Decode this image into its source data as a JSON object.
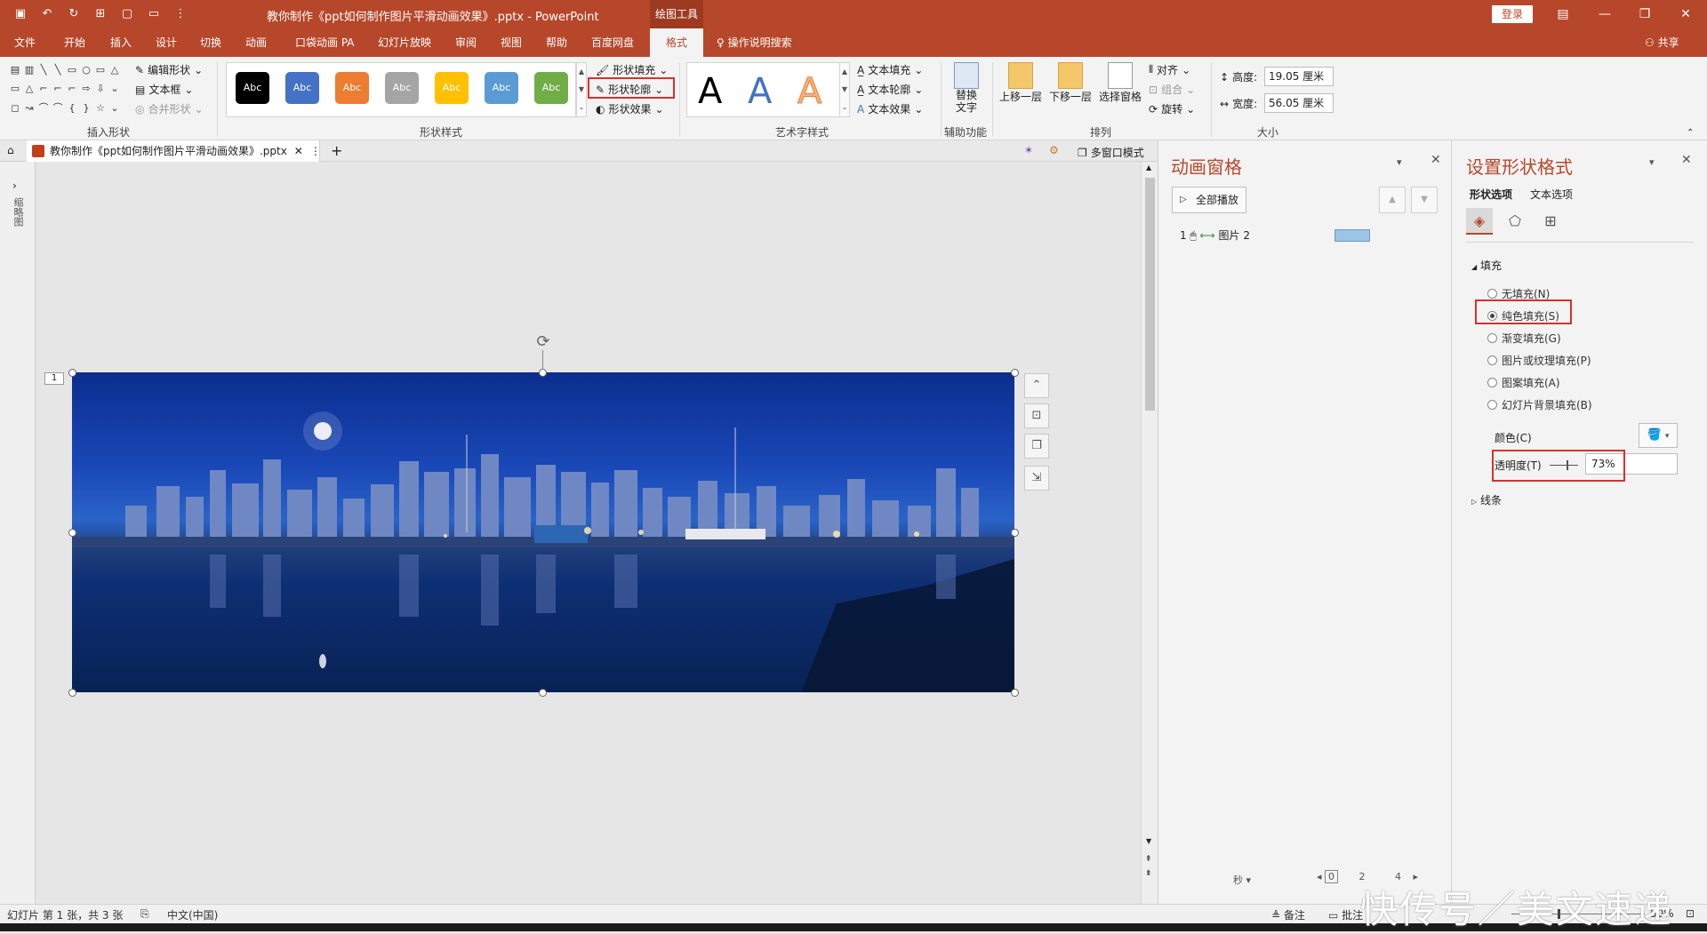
{
  "window": {
    "title": "教你制作《ppt如何制作图片平滑动画效果》.pptx - PowerPoint",
    "contextual_tab": "绘图工具",
    "login": "登录"
  },
  "tabs": [
    "文件",
    "开始",
    "插入",
    "设计",
    "切换",
    "动画",
    "口袋动画 PA",
    "幻灯片放映",
    "审阅",
    "视图",
    "帮助",
    "百度网盘",
    "格式"
  ],
  "tell_me": "操作说明搜索",
  "share": "共享",
  "ribbon": {
    "insert_shapes": {
      "label": "插入形状",
      "edit_shape": "编辑形状",
      "text_box": "文本框",
      "merge_shapes": "合并形状"
    },
    "shape_styles": {
      "label": "形状样式",
      "swatch_text": "Abc",
      "fill": "形状填充",
      "outline": "形状轮廓",
      "effects": "形状效果"
    },
    "wordart": {
      "label": "艺术字样式",
      "letter": "A",
      "text_fill": "文本填充",
      "text_outline": "文本轮廓",
      "text_effects": "文本效果"
    },
    "accessibility": {
      "label": "辅助功能",
      "alt_text": "替换文字"
    },
    "arrange": {
      "label": "排列",
      "bring_forward": "上移一层",
      "send_backward": "下移一层",
      "selection_pane": "选择窗格",
      "align": "对齐",
      "group": "组合",
      "rotate": "旋转"
    },
    "size": {
      "label": "大小",
      "height_label": "高度:",
      "height_value": "19.05 厘米",
      "width_label": "宽度:",
      "width_value": "56.05 厘米"
    }
  },
  "doc_tab": {
    "name": "教你制作《ppt如何制作图片平滑动画效果》.pptx",
    "multiwindow": "多窗口模式"
  },
  "thumbnails_label": "缩略图",
  "slide_number": "1",
  "animation_pane": {
    "title": "动画窗格",
    "play_all": "全部播放",
    "item_index": "1",
    "item_name": "图片 2",
    "seconds": "秒",
    "timeline": [
      "0",
      "2",
      "4"
    ]
  },
  "format_pane": {
    "title": "设置形状格式",
    "tab_shape": "形状选项",
    "tab_text": "文本选项",
    "fill_section": "填充",
    "options": [
      "无填充(N)",
      "纯色填充(S)",
      "渐变填充(G)",
      "图片或纹理填充(P)",
      "图案填充(A)",
      "幻灯片背景填充(B)"
    ],
    "selected_index": 1,
    "color_label": "颜色(C)",
    "transparency_label": "透明度(T)",
    "transparency_value": "73%",
    "line_section": "线条"
  },
  "status": {
    "slide_info": "幻灯片 第 1 张，共 3 张",
    "language": "中文(中国)",
    "notes": "备注",
    "comments": "批注",
    "zoom": "50%"
  },
  "watermark": "快传号／美文速递",
  "colors": {
    "accent": "#b7472a",
    "highlight": "#d9302c"
  }
}
